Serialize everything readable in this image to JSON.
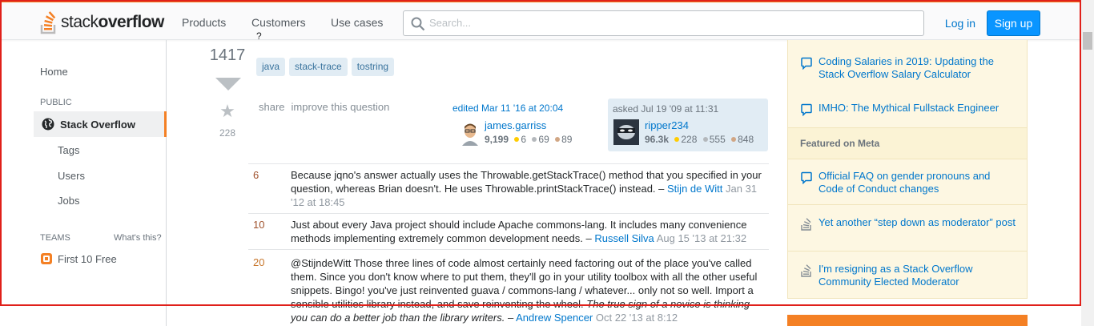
{
  "header": {
    "logo_prefix": "stack",
    "logo_suffix": "overflow",
    "nav": [
      "Products",
      "Customers",
      "Use cases"
    ],
    "search_placeholder": "Search...",
    "login_label": "Log in",
    "signup_label": "Sign up",
    "brand_color": "#f48024",
    "accent_color": "#0a95ff"
  },
  "sidebar": {
    "home": "Home",
    "public_label": "PUBLIC",
    "active_item": "Stack Overflow",
    "sub_items": [
      "Tags",
      "Users",
      "Jobs"
    ],
    "teams_label": "TEAMS",
    "whats_this": "What's this?",
    "teams_item": "First 10 Free"
  },
  "question": {
    "title_fragment": "?",
    "votes": "1417",
    "favorites": "228",
    "tags": [
      "java",
      "stack-trace",
      "tostring"
    ],
    "menu": [
      "share",
      "improve this question"
    ],
    "edited": {
      "time": "edited Mar 11 '16 at 20:04",
      "user": "james.garriss",
      "rep": "9,199",
      "gold": "6",
      "silver": "69",
      "bronze": "89"
    },
    "asked": {
      "time": "asked Jul 19 '09 at 11:31",
      "user": "ripper234",
      "rep": "96.3k",
      "gold": "228",
      "silver": "555",
      "bronze": "848"
    }
  },
  "comments": [
    {
      "score": "6",
      "text": "Because jqno's answer actually uses the Throwable.getStackTrace() method that you specified in your question, whereas Brian doesn't. He uses Throwable.printStackTrace() instead. –",
      "user": "Stijn de Witt",
      "date": "Jan 31 '12 at 18:45"
    },
    {
      "score": "10",
      "text": "Just about every Java project should include Apache commons-lang. It includes many convenience methods implementing extremely common development needs. –",
      "user": "Russell Silva",
      "date": "Aug 15 '13 at 21:32"
    },
    {
      "score": "20",
      "text": "@StijndeWitt Those three lines of code almost certainly need factoring out of the place you've called them. Since you don't know where to put them, they'll go in your utility toolbox with all the other useful snippets. Bingo! you've just reinvented guava / commons-lang / whatever... only not so well. Import a sensible utilities library instead, and save reinventing the wheel.",
      "italic": "The true sign of a novice is thinking you can do a better job than the library writers.",
      "dash": "–",
      "user": "Andrew Spencer",
      "date": "Oct 22 '13 at 8:12"
    }
  ],
  "right_sidebar": {
    "blog_items": [
      "Coding Salaries in 2019: Updating the Stack Overflow Salary Calculator",
      "IMHO: The Mythical Fullstack Engineer"
    ],
    "meta_heading": "Featured on Meta",
    "meta_items": [
      "Official FAQ on gender pronouns and Code of Conduct changes",
      "Yet another “step down as moderator” post",
      "I'm resigning as a Stack Overflow Community Elected Moderator"
    ]
  }
}
